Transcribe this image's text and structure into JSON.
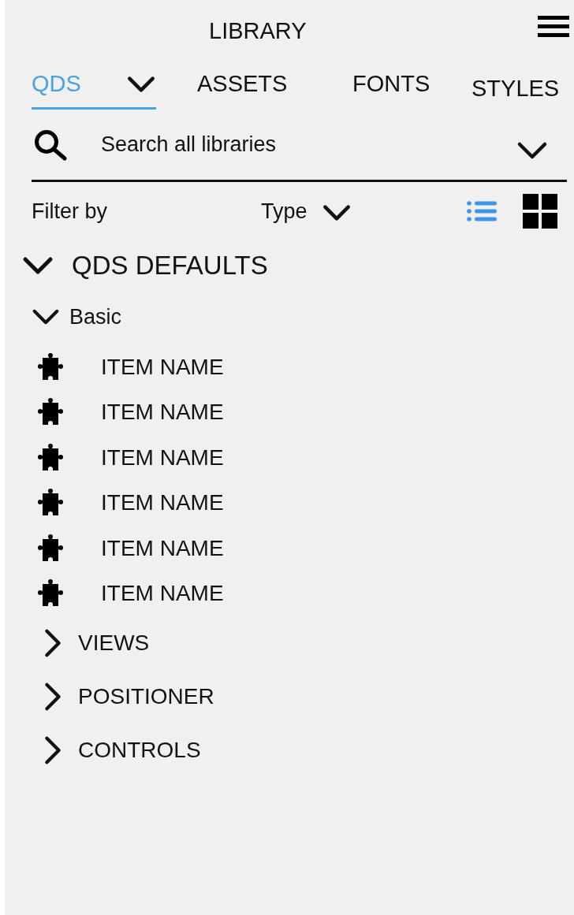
{
  "header": {
    "title": "LIBRARY"
  },
  "tabs": [
    {
      "label": "QDS",
      "selected": true,
      "dropdown": true
    },
    {
      "label": "ASSETS",
      "selected": false,
      "dropdown": false
    },
    {
      "label": "FONTS",
      "selected": false,
      "dropdown": false
    },
    {
      "label": "STYLES",
      "selected": false,
      "dropdown": false
    }
  ],
  "search": {
    "placeholder": "Search all libraries"
  },
  "filter": {
    "label": "Filter by",
    "type": "Type"
  },
  "view_modes": [
    {
      "kind": "list",
      "selected": true
    },
    {
      "kind": "grid",
      "selected": false
    }
  ],
  "tree": {
    "label": "QDS DEFAULTS",
    "expanded": true,
    "children": [
      {
        "label": "Basic",
        "expanded": true,
        "children": [
          {
            "label": "ITEM NAME"
          },
          {
            "label": "ITEM NAME"
          },
          {
            "label": "ITEM NAME"
          },
          {
            "label": "ITEM NAME"
          },
          {
            "label": "ITEM NAME"
          },
          {
            "label": "ITEM NAME"
          }
        ]
      },
      {
        "label": "VIEWS",
        "expanded": false
      },
      {
        "label": "POSITIONER",
        "expanded": false
      },
      {
        "label": "CONTROLS",
        "expanded": false
      }
    ]
  }
}
